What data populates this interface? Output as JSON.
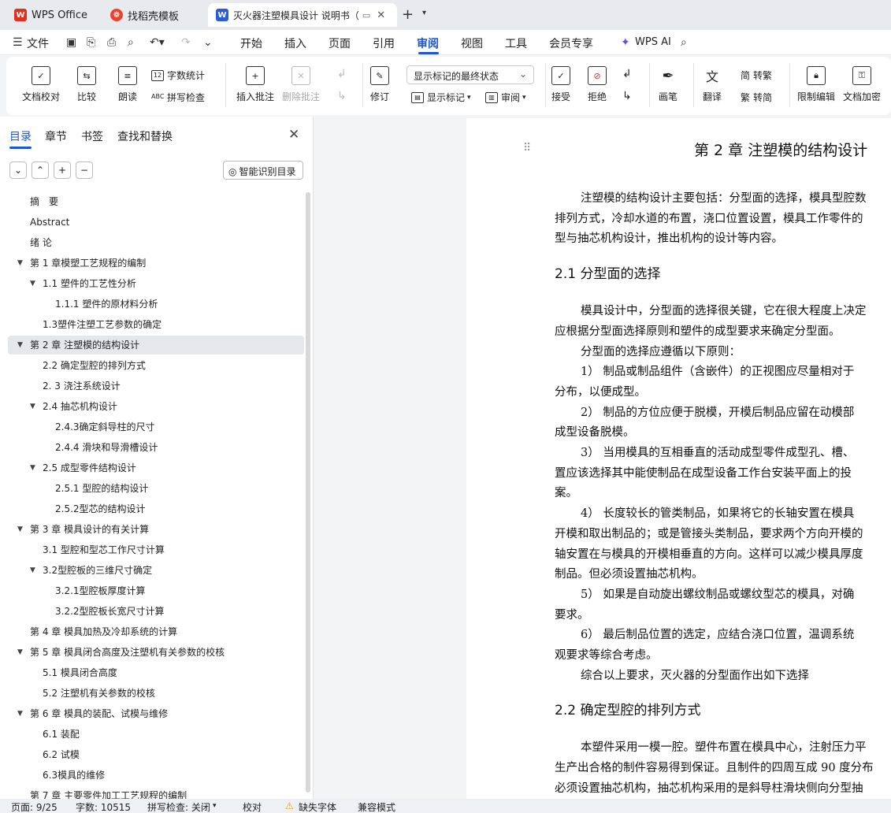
{
  "tabs": [
    {
      "label": "WPS Office",
      "icon": "wps-logo-icon"
    },
    {
      "label": "找稻壳模板",
      "icon": "docer-icon"
    },
    {
      "label": "灭火器注塑模具设计 说明书（",
      "icon": "word-doc-icon"
    }
  ],
  "menu": {
    "file": "文件",
    "items": [
      "开始",
      "插入",
      "页面",
      "引用",
      "审阅",
      "视图",
      "工具",
      "会员专享"
    ],
    "active": "审阅",
    "ai": "WPS AI"
  },
  "ribbon": {
    "doc_check": "文档校对",
    "compare": "比较",
    "read_aloud": "朗读",
    "word_count": "字数统计",
    "spell_check": "拼写检查",
    "insert_comment": "插入批注",
    "delete_comment": "删除批注",
    "revise": "修订",
    "markup_state": "显示标记的最终状态",
    "show_markup": "显示标记",
    "review": "审阅",
    "accept": "接受",
    "reject": "拒绝",
    "pen": "画笔",
    "translate": "翻译",
    "to_traditional": "转繁",
    "to_simplified": "转简",
    "restrict_edit": "限制编辑",
    "doc_encrypt": "文档加密"
  },
  "panel": {
    "tabs": [
      "目录",
      "章节",
      "书签",
      "查找和替换"
    ],
    "smart_toc": "智能识别目录",
    "toc": [
      {
        "label": "摘　要",
        "level": 1
      },
      {
        "label": "Abstract",
        "level": 1
      },
      {
        "label": "绪 论",
        "level": 1
      },
      {
        "label": "第 1 章模塑工艺规程的编制",
        "level": 1,
        "expanded": true
      },
      {
        "label": "1.1  塑件的工艺性分析",
        "level": 2,
        "expanded": true
      },
      {
        "label": "1.1.1    塑件的原材料分析",
        "level": 3
      },
      {
        "label": "1.3塑件注塑工艺参数的确定",
        "level": 2
      },
      {
        "label": "第 2 章  注塑模的结构设计",
        "level": 1,
        "expanded": true,
        "selected": true
      },
      {
        "label": "2.2  确定型腔的排列方式",
        "level": 2
      },
      {
        "label": "2.  3  浇注系统设计",
        "level": 2
      },
      {
        "label": "2.4  抽芯机构设计",
        "level": 2,
        "expanded": true
      },
      {
        "label": "2.4.3确定斜导柱的尺寸",
        "level": 3
      },
      {
        "label": "2.4.4  滑块和导滑槽设计",
        "level": 3
      },
      {
        "label": "2.5  成型零件结构设计",
        "level": 2,
        "expanded": true
      },
      {
        "label": "2.5.1  型腔的结构设计",
        "level": 3
      },
      {
        "label": "2.5.2型芯的结构设计",
        "level": 3
      },
      {
        "label": "第 3 章  模具设计的有关计算",
        "level": 1,
        "expanded": true
      },
      {
        "label": "3.1  型腔和型芯工作尺寸计算",
        "level": 2
      },
      {
        "label": "3.2型腔板的三维尺寸确定",
        "level": 2,
        "expanded": true
      },
      {
        "label": "3.2.1型腔板厚度计算",
        "level": 3
      },
      {
        "label": "3.2.2型腔板长宽尺寸计算",
        "level": 3
      },
      {
        "label": "第 4 章  模具加热及冷却系统的计算",
        "level": 1
      },
      {
        "label": "第 5 章  模具闭合高度及注塑机有关参数的校核",
        "level": 1,
        "expanded": true
      },
      {
        "label": "5.1  模具闭合高度",
        "level": 2
      },
      {
        "label": "5.2  注塑机有关参数的校核",
        "level": 2
      },
      {
        "label": "第 6 章  模具的装配、试模与维修",
        "level": 1,
        "expanded": true
      },
      {
        "label": "6.1  装配",
        "level": 2
      },
      {
        "label": "6.2  试模",
        "level": 2
      },
      {
        "label": "6.3模具的维修",
        "level": 2
      },
      {
        "label": "第 7 章  主要零件加工工艺规程的编制",
        "level": 1
      }
    ]
  },
  "doc": {
    "chapter_title": "第 2 章  注塑模的结构设计",
    "lines": [
      {
        "text": "注塑模的结构设计主要包括：分型面的选择，模具型腔数",
        "indent": true,
        "type": "p"
      },
      {
        "text": "排列方式，冷却水道的布置，浇口位置设置，模具工作零件的",
        "indent": false,
        "type": "p"
      },
      {
        "text": "型与抽芯机构设计，推出机构的设计等内容。",
        "indent": false,
        "type": "p"
      },
      {
        "text": "2.1  分型面的选择",
        "type": "h2"
      },
      {
        "text": "模具设计中，分型面的选择很关键，它在很大程度上决定",
        "indent": true,
        "type": "p"
      },
      {
        "text": "应根据分型面选择原则和塑件的成型要求来确定分型面。",
        "indent": false,
        "type": "p"
      },
      {
        "text": "分型面的选择应遵循以下原则：",
        "indent": true,
        "type": "p"
      },
      {
        "text": "1）      制品或制品组件（含嵌件）的正视图应尽量相对于",
        "indent": true,
        "type": "p"
      },
      {
        "text": "分布，以便成型。",
        "indent": false,
        "type": "p"
      },
      {
        "text": "2）      制品的方位应便于脱模，开模后制品应留在动模部",
        "indent": true,
        "type": "p"
      },
      {
        "text": "成型设备脱模。",
        "indent": false,
        "type": "p"
      },
      {
        "text": "3）      当用模具的互相垂直的活动成型零件成型孔、槽、",
        "indent": true,
        "type": "p"
      },
      {
        "text": "置应该选择其中能使制品在成型设备工作台安装平面上的投",
        "indent": false,
        "type": "p"
      },
      {
        "text": "案。",
        "indent": false,
        "type": "p"
      },
      {
        "text": "4）      长度较长的管类制品，如果将它的长轴安置在模具",
        "indent": true,
        "type": "p"
      },
      {
        "text": "开模和取出制品的；或是管接头类制品，要求两个方向开模的",
        "indent": false,
        "type": "p"
      },
      {
        "text": "轴安置在与模具的开模相垂直的方向。这样可以减少模具厚度",
        "indent": false,
        "type": "p"
      },
      {
        "text": "制品。但必须设置抽芯机构。",
        "indent": false,
        "type": "p"
      },
      {
        "text": "5）      如果是自动旋出螺纹制品或螺纹型芯的模具，对确",
        "indent": true,
        "type": "p"
      },
      {
        "text": "要求。",
        "indent": false,
        "type": "p"
      },
      {
        "text": "6）      最后制品位置的选定，应结合浇口位置，温调系统",
        "indent": true,
        "type": "p"
      },
      {
        "text": "观要求等综合考虑。",
        "indent": false,
        "type": "p"
      },
      {
        "text": "综合以上要求，灭火器的分型面作出如下选择",
        "indent": true,
        "type": "p"
      },
      {
        "text": "2.2  确定型腔的排列方式",
        "type": "h2"
      },
      {
        "text": "本塑件采用一模一腔。塑件布置在模具中心，注射压力平",
        "indent": true,
        "type": "p"
      },
      {
        "text": "生产出合格的制件容易得到保证。且制件的四周互成 90 度分布",
        "indent": false,
        "type": "p"
      },
      {
        "text": "必须设置抽芯机构，抽芯机构采用的是斜导柱滑块侧向分型抽",
        "indent": false,
        "type": "p"
      }
    ]
  },
  "status": {
    "page": "页面: 9/25",
    "words": "字数: 10515",
    "spell": "拼写检查: 关闭",
    "proof": "校对",
    "missing_font": "缺失字体",
    "compat": "兼容模式"
  },
  "colors": {
    "accent": "#1a56d6",
    "wps_red": "#e0301e",
    "docer": "#e8432f",
    "word_blue": "#2b5bd7"
  }
}
